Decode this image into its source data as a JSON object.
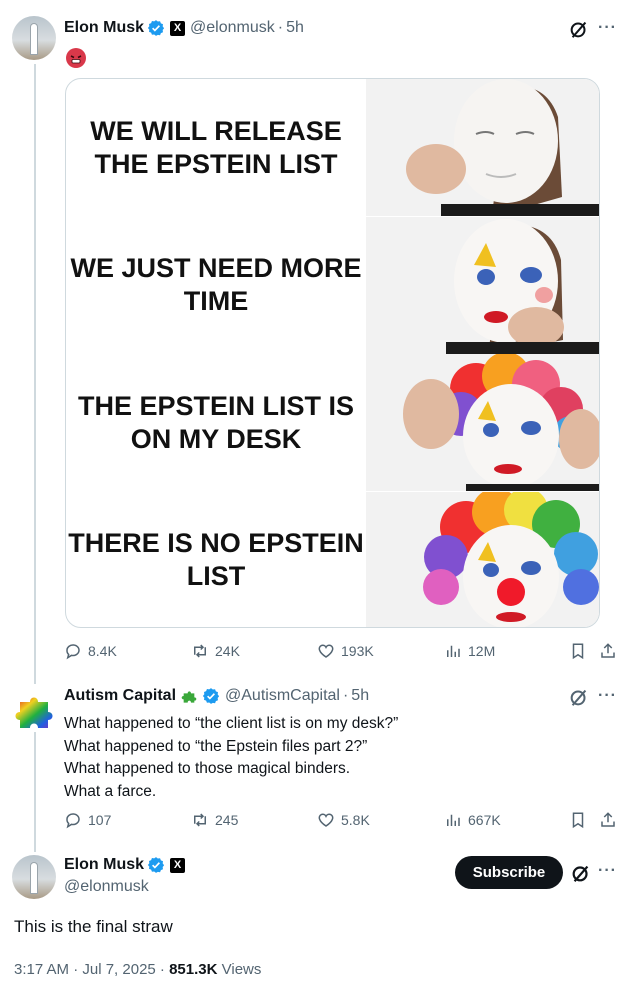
{
  "post": {
    "author_name": "Elon Musk",
    "handle": "@elonmusk",
    "time": "5h",
    "emoji": "angry-face-emoji",
    "meme": {
      "panels": [
        {
          "text": "WE WILL RELEASE THE EPSTEIN LIST"
        },
        {
          "text": "WE JUST NEED MORE TIME"
        },
        {
          "text": "THE EPSTEIN LIST IS ON MY DESK"
        },
        {
          "text": "THERE IS NO EPSTEIN LIST"
        }
      ]
    },
    "stats": {
      "replies": "8.4K",
      "reposts": "24K",
      "likes": "193K",
      "views": "12M"
    }
  },
  "reply": {
    "author_name": "Autism Capital",
    "handle": "@AutismCapital",
    "time": "5h",
    "lines": [
      "What happened to “the client list is on my desk?”",
      "What happened to “the Epstein files part 2?”",
      "What happened to those magical binders.",
      "What a farce."
    ],
    "stats": {
      "replies": "107",
      "reposts": "245",
      "likes": "5.8K",
      "views": "667K"
    }
  },
  "main_post": {
    "author_name": "Elon Musk",
    "handle": "@elonmusk",
    "subscribe_label": "Subscribe",
    "text": "This is the final straw",
    "timestamp": "3:17 AM · Jul 7, 2025 · ",
    "views_count": "851.3K",
    "views_label": " Views"
  },
  "colors": {
    "verified": "#1d9bf0",
    "text_primary": "#0f1419",
    "text_secondary": "#536471",
    "border": "#cfd9de"
  }
}
